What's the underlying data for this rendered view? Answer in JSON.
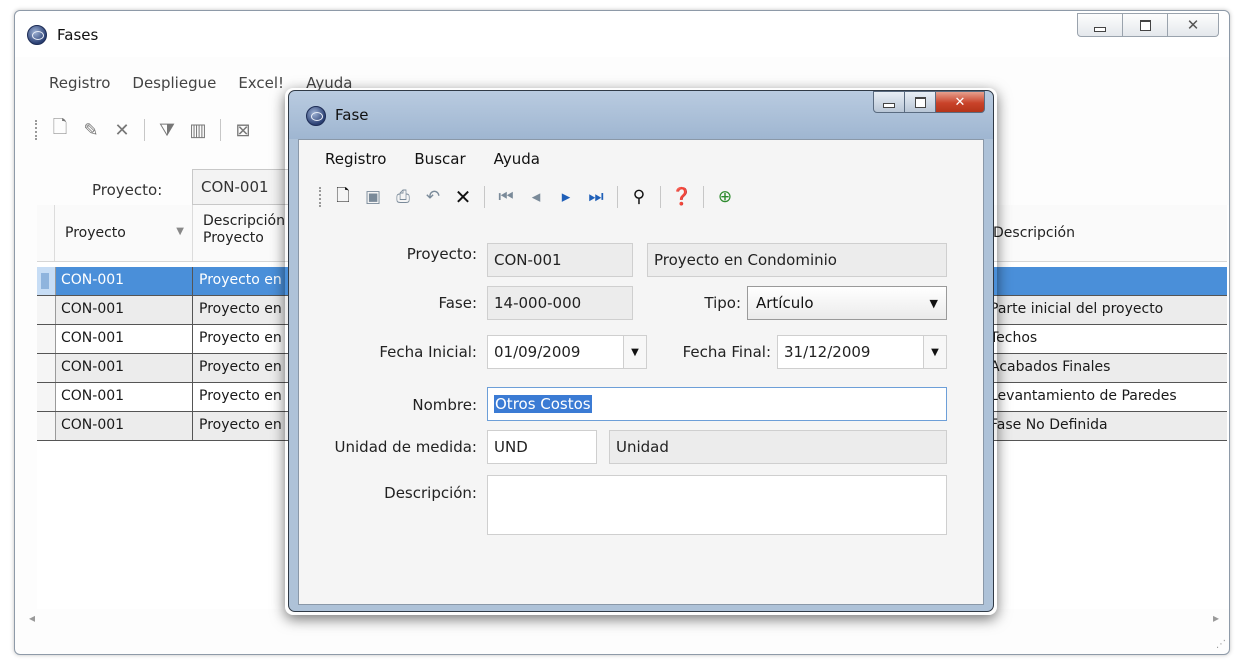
{
  "main_window": {
    "title": "Fases",
    "menu": [
      "Registro",
      "Despliegue",
      "Excel!",
      "Ayuda"
    ],
    "project_filter": {
      "label": "Proyecto:",
      "value": "CON-001"
    },
    "grid": {
      "columns": {
        "proyecto": "Proyecto",
        "descripcion_proyecto": "Descripción\nProyecto",
        "descripcion": "Descripción"
      },
      "rows": [
        {
          "proyecto": "CON-001",
          "descripcion_proyecto": "Proyecto en",
          "descripcion": ""
        },
        {
          "proyecto": "CON-001",
          "descripcion_proyecto": "Proyecto en",
          "descripcion": "Parte inicial del proyecto"
        },
        {
          "proyecto": "CON-001",
          "descripcion_proyecto": "Proyecto en",
          "descripcion": "Techos"
        },
        {
          "proyecto": "CON-001",
          "descripcion_proyecto": "Proyecto en",
          "descripcion": "Acabados Finales"
        },
        {
          "proyecto": "CON-001",
          "descripcion_proyecto": "Proyecto en",
          "descripcion": "Levantamiento de Paredes"
        },
        {
          "proyecto": "CON-001",
          "descripcion_proyecto": "Proyecto en",
          "descripcion": "Fase No Definida"
        }
      ]
    }
  },
  "dialog": {
    "title": "Fase",
    "menu": [
      "Registro",
      "Buscar",
      "Ayuda"
    ],
    "fields": {
      "proyecto": {
        "label": "Proyecto:",
        "code": "CON-001",
        "name": "Proyecto en Condominio"
      },
      "fase": {
        "label": "Fase:",
        "value": "14-000-000"
      },
      "tipo": {
        "label": "Tipo:",
        "value": "Artículo"
      },
      "fecha_inicial": {
        "label": "Fecha Inicial:",
        "value": "01/09/2009"
      },
      "fecha_final": {
        "label": "Fecha Final:",
        "value": "31/12/2009"
      },
      "nombre": {
        "label": "Nombre:",
        "value": "Otros Costos"
      },
      "unidad": {
        "label": "Unidad de medida:",
        "code": "UND",
        "name": "Unidad"
      },
      "descripcion": {
        "label": "Descripción:",
        "value": ""
      }
    }
  },
  "icons": {
    "toolbar_main": [
      "new-icon",
      "edit-icon",
      "delete-icon",
      "filter-icon",
      "columns-icon",
      "export-icon"
    ],
    "toolbar_dialog": [
      "new-icon",
      "save-icon",
      "print-icon",
      "undo-icon",
      "delete-icon",
      "first-icon",
      "prev-icon",
      "next-icon",
      "last-icon",
      "search-icon",
      "help-icon",
      "exit-icon"
    ]
  },
  "colors": {
    "selected_row": "#4a8fd9",
    "dialog_frame": "#aec2d8",
    "close_button": "#c9432a"
  }
}
